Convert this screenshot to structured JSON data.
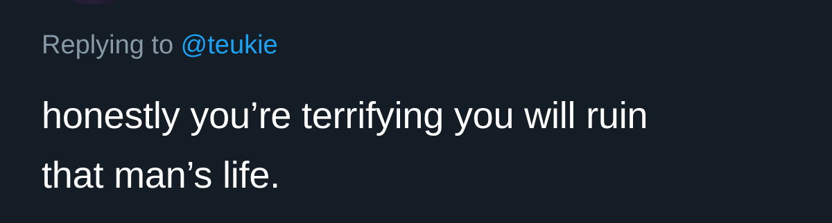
{
  "colors": {
    "background": "#141d26",
    "muted_text": "#8899a6",
    "link": "#1da1f2",
    "body_text": "#ffffff"
  },
  "reply": {
    "prefix": "Replying to ",
    "handle": "@teukie"
  },
  "tweet": {
    "lines": [
      "honestly you’re terrifying you will ruin",
      "that man’s life."
    ]
  }
}
